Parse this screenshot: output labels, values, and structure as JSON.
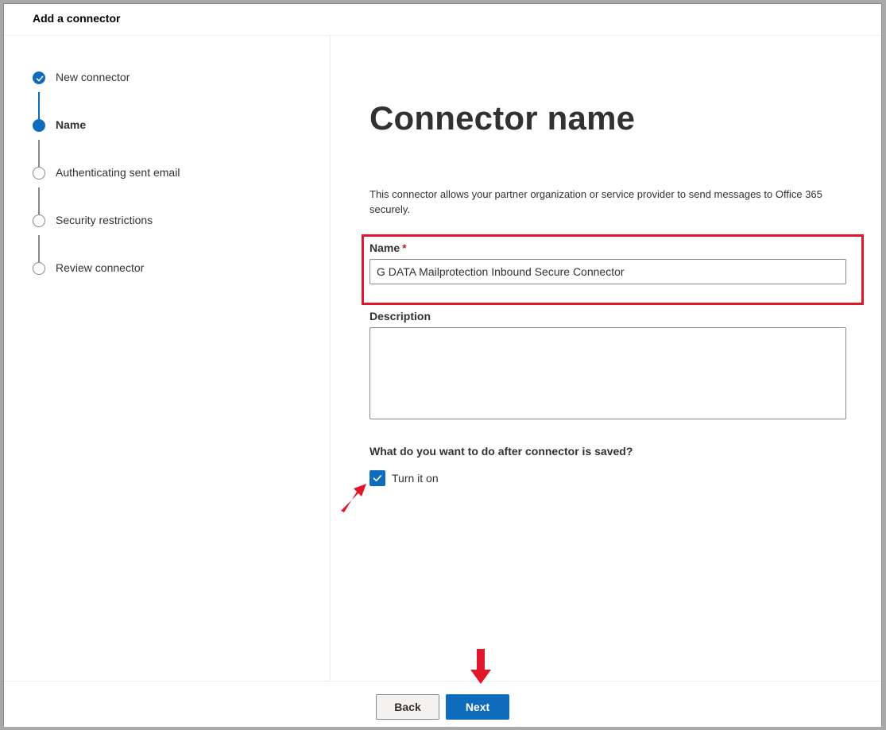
{
  "window": {
    "title": "Add a connector"
  },
  "steps": [
    {
      "label": "New connector",
      "state": "done"
    },
    {
      "label": "Name",
      "state": "current"
    },
    {
      "label": "Authenticating sent email",
      "state": "pending"
    },
    {
      "label": "Security restrictions",
      "state": "pending"
    },
    {
      "label": "Review connector",
      "state": "pending"
    }
  ],
  "main": {
    "title": "Connector name",
    "description": "This connector allows your partner organization or service provider to send messages to Office 365 securely.",
    "name_field": {
      "label": "Name",
      "required_mark": "*",
      "value": "G DATA Mailprotection Inbound Secure Connector"
    },
    "description_field": {
      "label": "Description",
      "value": ""
    },
    "after_save": {
      "question": "What do you want to do after connector is saved?",
      "checkbox_label": "Turn it on",
      "checked": true
    }
  },
  "footer": {
    "back_label": "Back",
    "next_label": "Next"
  },
  "colors": {
    "accent": "#0f6cbd",
    "highlight": "#e0162b",
    "annotation_arrow": "#e0162b"
  },
  "icons": [
    "checkmark-icon",
    "annotation-arrow-icon"
  ]
}
